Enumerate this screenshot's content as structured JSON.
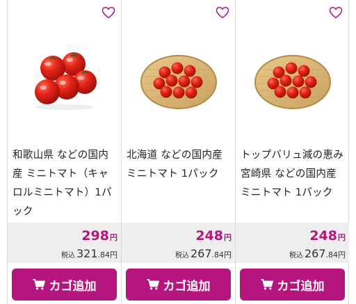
{
  "colors": {
    "accent": "#b5167e",
    "price_bg": "#eeeeee"
  },
  "products": [
    {
      "name": "和歌山県 などの国内産 ミニトマト（キャロルミニトマト）1パック",
      "price": "298",
      "yen": "円",
      "tax_label": "税込",
      "tax_int": "321",
      "tax_dec": ".84",
      "tax_yen": "円",
      "button_label": "カゴ追加",
      "image": "tomatoes-loose"
    },
    {
      "name": "北海道 などの国内産 ミニトマト 1パック",
      "price": "248",
      "yen": "円",
      "tax_label": "税込",
      "tax_int": "267",
      "tax_dec": ".84",
      "tax_yen": "円",
      "button_label": "カゴ追加",
      "image": "tomatoes-basket"
    },
    {
      "name": "トップバリュ減の恵み 宮崎県 などの国内産 ミニトマト 1パック",
      "price": "248",
      "yen": "円",
      "tax_label": "税込",
      "tax_int": "267",
      "tax_dec": ".84",
      "tax_yen": "円",
      "button_label": "カゴ追加",
      "image": "tomatoes-basket"
    }
  ]
}
